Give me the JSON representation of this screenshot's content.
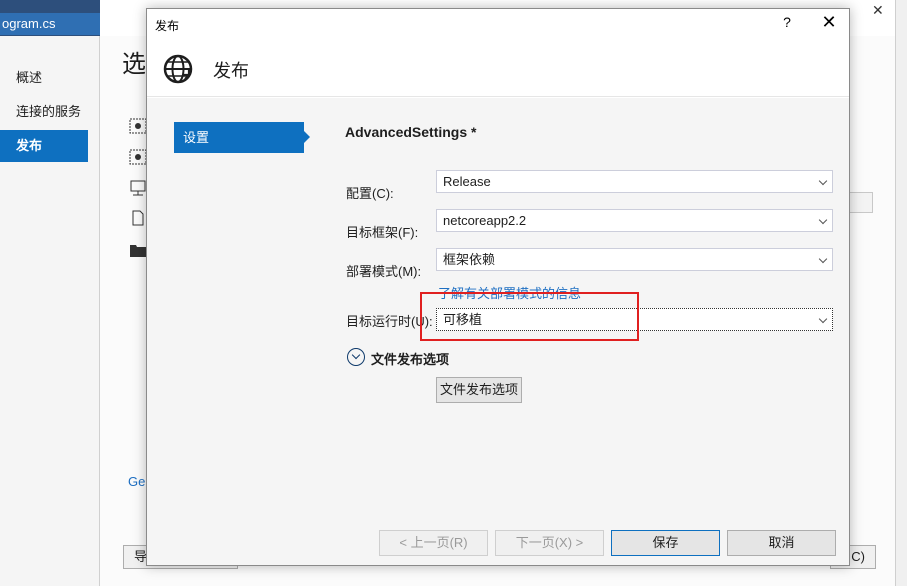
{
  "background": {
    "tab_label": "ogram.cs",
    "heading": "选",
    "nav_items": [
      {
        "label": "概述"
      },
      {
        "label": "连接的服务"
      },
      {
        "label": "发布"
      }
    ],
    "link_text": "Ge",
    "left_button_label": "导",
    "right_button_label": "C)"
  },
  "dialog": {
    "title": "发布",
    "help_label": "?",
    "close_label": "✕",
    "header_title": "发布",
    "steps": [
      {
        "label": "设置"
      }
    ],
    "section_title": "AdvancedSettings *",
    "fields": {
      "configuration": {
        "label": "配置(C):",
        "value": "Release"
      },
      "target_framework": {
        "label": "目标框架(F):",
        "value": "netcoreapp2.2"
      },
      "deployment_mode": {
        "label": "部署模式(M):",
        "value": "框架依赖"
      },
      "target_runtime": {
        "label": "目标运行时(U):",
        "value": "可移植"
      }
    },
    "deployment_link": "了解有关部署模式的信息",
    "file_publish_section": "文件发布选项",
    "file_publish_button": "文件发布选项",
    "buttons": {
      "previous": "< 上一页(R)",
      "next": "下一页(X) >",
      "save": "保存",
      "cancel": "取消"
    }
  },
  "colors": {
    "accent": "#0e70c0",
    "highlight_box": "#e02020",
    "link": "#1e6fc2"
  }
}
